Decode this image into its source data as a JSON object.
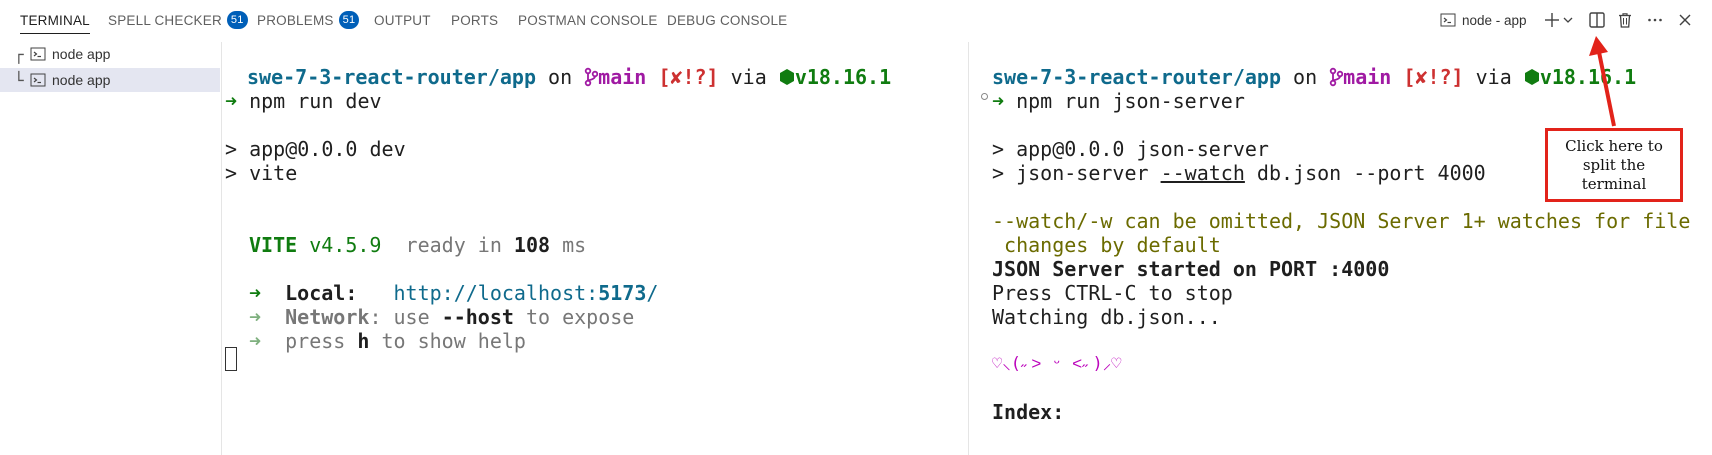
{
  "tabs": [
    {
      "label": "TERMINAL",
      "active": true
    },
    {
      "label": "SPELL CHECKER",
      "badge": "51"
    },
    {
      "label": "PROBLEMS",
      "badge": "51"
    },
    {
      "label": "OUTPUT"
    },
    {
      "label": "PORTS"
    },
    {
      "label": "POSTMAN CONSOLE"
    },
    {
      "label": "DEBUG CONSOLE"
    }
  ],
  "toolbar": {
    "terminal_name": "node - app",
    "icons": [
      "terminal-icon",
      "plus-icon",
      "chevron-down-icon",
      "split-icon",
      "trash-icon",
      "more-icon",
      "close-icon"
    ]
  },
  "tree": {
    "items": [
      {
        "label": "node app",
        "connector": "┌"
      },
      {
        "label": "node app",
        "connector": "└",
        "selected": true
      }
    ]
  },
  "left_terminal": {
    "prompt": {
      "path": "swe-7-3-react-router/app",
      "on": " on ",
      "branch_icon": "git-branch-icon",
      "branch": "main",
      "status": "[✘!?]",
      "via": " via ",
      "node_icon": "node-hexagon-icon",
      "node_version": "v18.16.1"
    },
    "arrow": "➜",
    "command": " npm run dev",
    "out1": "> app@0.0.0 dev",
    "out2": "> vite",
    "vite_label": "VITE",
    "vite_version": " v4.5.9",
    "ready_text": "  ready in ",
    "ready_ms": "108",
    "ms": " ms",
    "local_label": "Local:",
    "local_url_prefix": "http://localhost:",
    "local_port": "5173",
    "local_url_suffix": "/",
    "network_label": "Network",
    "network_rest1": ": use ",
    "network_host": "--host",
    "network_rest2": " to expose",
    "help_prefix": "press ",
    "help_key": "h",
    "help_suffix": " to show help"
  },
  "right_terminal": {
    "prompt": {
      "path": "swe-7-3-react-router/app",
      "on": " on ",
      "branch": "main",
      "status": "[✘!?]",
      "via": " via ",
      "node_version": "v18.16.1"
    },
    "arrow": "➜",
    "command": " npm run json-server",
    "out1": "> app@0.0.0 json-server",
    "out2_prefix": "> json-server ",
    "out2_watch": "--watch",
    "out2_suffix": " db.json --port 4000",
    "warn1": "--watch/-w can be omitted, JSON Server 1+ watches for file",
    "warn2": " changes by default",
    "started": "JSON Server started on PORT :4000",
    "ctrl_c": "Press CTRL-C to stop",
    "watching": "Watching db.json...",
    "kaomoji": "♡⸜(˶˃ ᵕ ˂˶)⸝♡",
    "index": "Index:"
  },
  "annotation": {
    "text": "Click here to split the terminal",
    "color": "#e2231a"
  }
}
